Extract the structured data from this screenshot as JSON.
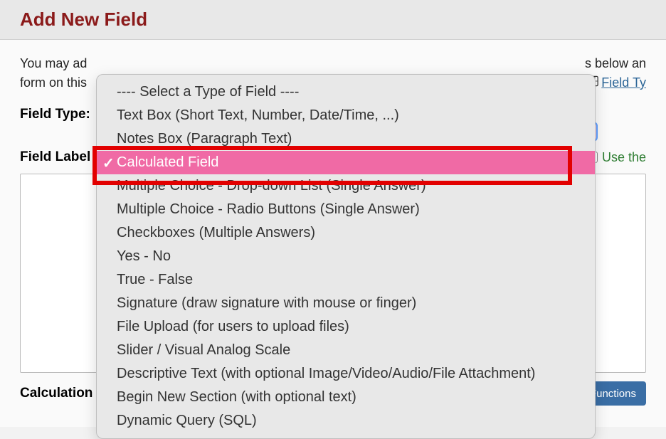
{
  "header": {
    "title": "Add New Field"
  },
  "intro": {
    "line1_prefix": "You may ad",
    "line1_suffix": "s below an",
    "line2_prefix": "form on this",
    "video_link": "Field Ty"
  },
  "field_type": {
    "label": "Field Type:"
  },
  "field_label": {
    "label": "Field Label",
    "use_the": "Use the"
  },
  "bottom": {
    "label": "Calculation Equation",
    "button": "Special Functions"
  },
  "dropdown": {
    "items": [
      {
        "label": "---- Select a Type of Field ----",
        "selected": false
      },
      {
        "label": "Text Box (Short Text, Number, Date/Time, ...)",
        "selected": false
      },
      {
        "label": "Notes Box (Paragraph Text)",
        "selected": false
      },
      {
        "label": "Calculated Field",
        "selected": true
      },
      {
        "label": "Multiple Choice - Drop-down List (Single Answer)",
        "selected": false
      },
      {
        "label": "Multiple Choice - Radio Buttons (Single Answer)",
        "selected": false
      },
      {
        "label": "Checkboxes (Multiple Answers)",
        "selected": false
      },
      {
        "label": "Yes - No",
        "selected": false
      },
      {
        "label": "True - False",
        "selected": false
      },
      {
        "label": "Signature (draw signature with mouse or finger)",
        "selected": false
      },
      {
        "label": "File Upload (for users to upload files)",
        "selected": false
      },
      {
        "label": "Slider / Visual Analog Scale",
        "selected": false
      },
      {
        "label": "Descriptive Text (with optional Image/Video/Audio/File Attachment)",
        "selected": false
      },
      {
        "label": "Begin New Section (with optional text)",
        "selected": false
      },
      {
        "label": "Dynamic Query (SQL)",
        "selected": false
      }
    ]
  }
}
